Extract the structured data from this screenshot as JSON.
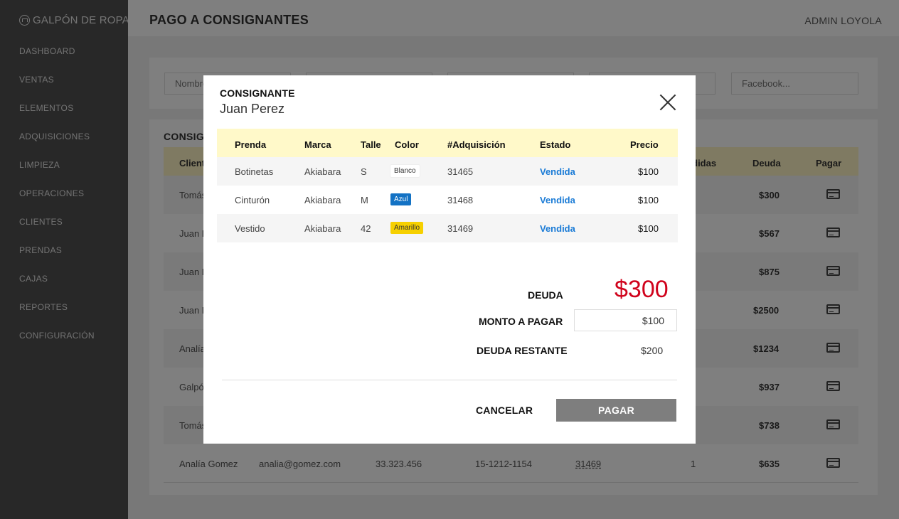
{
  "brand": {
    "name": "GALPÓN DE ROPA",
    "icon": "hanger-icon"
  },
  "sidebar": {
    "items": [
      {
        "label": "DASHBOARD"
      },
      {
        "label": "VENTAS"
      },
      {
        "label": "ELEMENTOS"
      },
      {
        "label": "ADQUISICIONES"
      },
      {
        "label": "LIMPIEZA"
      },
      {
        "label": "OPERACIONES"
      },
      {
        "label": "CLIENTES"
      },
      {
        "label": "PRENDAS"
      },
      {
        "label": "CAJAS"
      },
      {
        "label": "REPORTES"
      },
      {
        "label": "CONFIGURACIÓN"
      }
    ]
  },
  "header": {
    "title": "PAGO A CONSIGNANTES",
    "user": "ADMIN LOYOLA"
  },
  "filters": {
    "name_placeholder": "Nombre...",
    "facebook_placeholder": "Facebook..."
  },
  "list": {
    "title": "CONSIGNANTES",
    "columns": {
      "client": "Cliente",
      "sold": "Vendidas",
      "debt": "Deuda",
      "pay": "Pagar"
    },
    "rows": [
      {
        "client": "Tomás",
        "debt": "$300"
      },
      {
        "client": "Juan Perez",
        "debt": "$567"
      },
      {
        "client": "Juan Perez",
        "debt": "$875"
      },
      {
        "client": "Juan Perez",
        "debt": "$2500"
      },
      {
        "client": "Analía",
        "debt": "$1234"
      },
      {
        "client": "Galpón",
        "debt": "$937"
      },
      {
        "client": "Tomás",
        "debt": "$738"
      },
      {
        "client": "Analía Gomez",
        "email": "analia@gomez.com",
        "dni": "33.323.456",
        "phone": "15-1212-1154",
        "code": "31469",
        "sold": "1",
        "debt": "$635"
      }
    ]
  },
  "modal": {
    "label": "CONSIGNANTE",
    "name": "Juan Perez",
    "columns": {
      "item": "Prenda",
      "brand": "Marca",
      "size": "Talle",
      "color": "Color",
      "acq": "#Adquisición",
      "state": "Estado",
      "price": "Precio"
    },
    "rows": [
      {
        "item": "Botinetas",
        "brand": "Akiabara",
        "size": "S",
        "color": "Blanco",
        "acq": "31465",
        "state": "Vendida",
        "price": "$100"
      },
      {
        "item": "Cinturón",
        "brand": "Akiabara",
        "size": "M",
        "color": "Azul",
        "acq": "31468",
        "state": "Vendida",
        "price": "$100"
      },
      {
        "item": "Vestido",
        "brand": "Akiabara",
        "size": "42",
        "color": "Amarillo",
        "acq": "31469",
        "state": "Vendida",
        "price": "$100"
      }
    ],
    "debt_label": "DEUDA",
    "debt_value": "$300",
    "pay_label": "MONTO A PAGAR",
    "pay_value": "$100",
    "rest_label": "DEUDA RESTANTE",
    "rest_value": "$200",
    "cancel_label": "CANCELAR",
    "pay_button": "PAGAR"
  },
  "colors": {
    "sidebar": "#505050",
    "table_header": "#fff9c9",
    "debt_red": "#d0021b",
    "state_blue": "#1a7bd6",
    "chip_blue": "#1372c4",
    "chip_yellow": "#f6d000",
    "pay_button": "#7e7e7e"
  }
}
